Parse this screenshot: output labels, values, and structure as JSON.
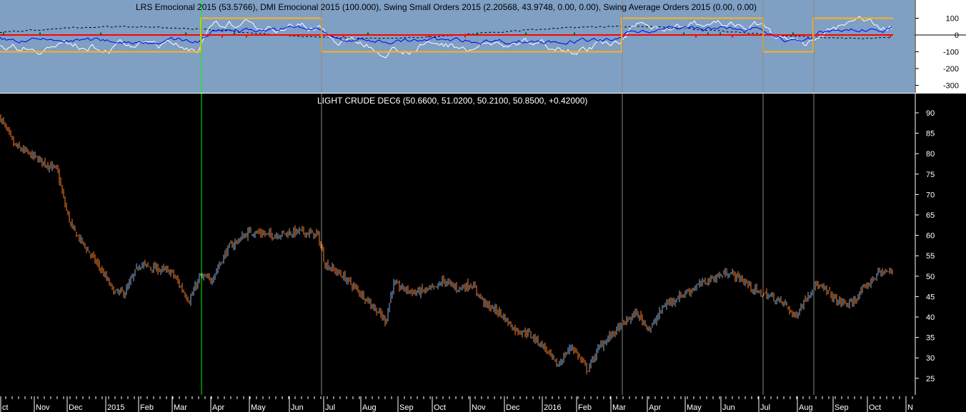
{
  "indicator_title": "LRS Emocional 2015 (53.5766), DMI Emocional 2015 (100.000), Swing Small Orders 2015 (2.20568, 43.9748, 0.00, 0.00), Swing Average Orders 2015 (0.00, 0.00)",
  "price_title": "LIGHT CRUDE DEC6 (50.6600, 51.0200, 50.2100, 50.8500, +0.42000)",
  "colors": {
    "up": "#8fb0d8",
    "down": "#ff7f27",
    "panel": "#7f9fc3",
    "step": "#ffb020",
    "zero": "#ff0000"
  },
  "chart_data": [
    {
      "type": "line",
      "title": "LRS Emocional / DMI Emocional / Swing Orders",
      "y_ticks": [
        100,
        0,
        -100,
        -200,
        -300
      ],
      "ylim": [
        -340,
        200
      ],
      "swing_step": [
        [
          0,
          -100
        ],
        [
          281,
          100
        ],
        [
          450,
          -100
        ],
        [
          870,
          100
        ],
        [
          1068,
          -100
        ],
        [
          1138,
          100
        ],
        [
          1250,
          100
        ]
      ]
    },
    {
      "type": "candlestick",
      "title": "LIGHT CRUDE DEC6",
      "ylim": [
        20,
        93
      ],
      "y_ticks": [
        90,
        85,
        80,
        75,
        70,
        65,
        60,
        55,
        50,
        45,
        40,
        35,
        30,
        25
      ],
      "x_ticks": [
        "ct",
        "Nov",
        "Dec",
        "2015",
        "Feb",
        "Mar",
        "Apr",
        "May",
        "Jun",
        "Jul",
        "Aug",
        "Sep",
        "Oct",
        "Nov",
        "Dec",
        "2016",
        "Feb",
        "Mar",
        "Apr",
        "May",
        "Jun",
        "Jul",
        "Aug",
        "Sep",
        "Oct",
        "N"
      ],
      "price_path": [
        [
          0,
          89
        ],
        [
          20,
          82
        ],
        [
          50,
          79
        ],
        [
          80,
          76
        ],
        [
          90,
          68
        ],
        [
          100,
          62
        ],
        [
          120,
          57
        ],
        [
          140,
          52
        ],
        [
          160,
          46
        ],
        [
          175,
          46
        ],
        [
          195,
          53
        ],
        [
          215,
          52
        ],
        [
          240,
          51
        ],
        [
          265,
          44
        ],
        [
          280,
          50
        ],
        [
          295,
          49
        ],
        [
          320,
          57
        ],
        [
          350,
          61
        ],
        [
          380,
          60
        ],
        [
          420,
          61
        ],
        [
          445,
          60
        ],
        [
          455,
          53
        ],
        [
          480,
          50
        ],
        [
          510,
          45
        ],
        [
          540,
          39
        ],
        [
          550,
          48
        ],
        [
          580,
          46
        ],
        [
          610,
          47
        ],
        [
          620,
          49
        ],
        [
          640,
          47
        ],
        [
          660,
          48
        ],
        [
          680,
          43
        ],
        [
          700,
          41
        ],
        [
          720,
          37
        ],
        [
          740,
          36
        ],
        [
          760,
          33
        ],
        [
          780,
          28
        ],
        [
          800,
          33
        ],
        [
          822,
          27
        ],
        [
          840,
          33
        ],
        [
          870,
          38
        ],
        [
          890,
          41
        ],
        [
          910,
          37
        ],
        [
          930,
          43
        ],
        [
          960,
          46
        ],
        [
          990,
          49
        ],
        [
          1020,
          51
        ],
        [
          1040,
          49
        ],
        [
          1060,
          46
        ],
        [
          1080,
          45
        ],
        [
          1100,
          43
        ],
        [
          1112,
          40
        ],
        [
          1140,
          48
        ],
        [
          1160,
          46
        ],
        [
          1170,
          44
        ],
        [
          1190,
          43
        ],
        [
          1210,
          47
        ],
        [
          1230,
          51
        ],
        [
          1250,
          51
        ]
      ]
    }
  ]
}
